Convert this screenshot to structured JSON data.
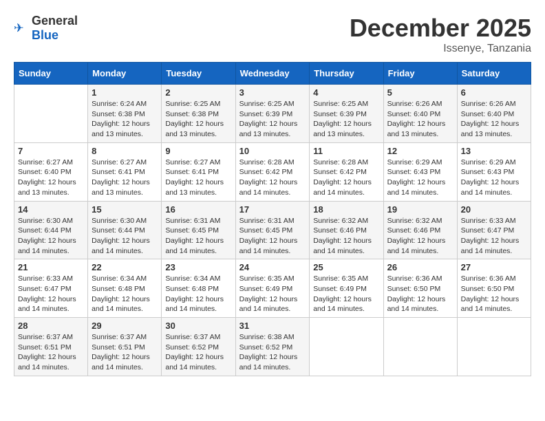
{
  "header": {
    "logo_general": "General",
    "logo_blue": "Blue",
    "month": "December 2025",
    "location": "Issenye, Tanzania"
  },
  "weekdays": [
    "Sunday",
    "Monday",
    "Tuesday",
    "Wednesday",
    "Thursday",
    "Friday",
    "Saturday"
  ],
  "weeks": [
    [
      {
        "day": "",
        "sunrise": "",
        "sunset": "",
        "daylight": ""
      },
      {
        "day": "1",
        "sunrise": "Sunrise: 6:24 AM",
        "sunset": "Sunset: 6:38 PM",
        "daylight": "Daylight: 12 hours and 13 minutes."
      },
      {
        "day": "2",
        "sunrise": "Sunrise: 6:25 AM",
        "sunset": "Sunset: 6:38 PM",
        "daylight": "Daylight: 12 hours and 13 minutes."
      },
      {
        "day": "3",
        "sunrise": "Sunrise: 6:25 AM",
        "sunset": "Sunset: 6:39 PM",
        "daylight": "Daylight: 12 hours and 13 minutes."
      },
      {
        "day": "4",
        "sunrise": "Sunrise: 6:25 AM",
        "sunset": "Sunset: 6:39 PM",
        "daylight": "Daylight: 12 hours and 13 minutes."
      },
      {
        "day": "5",
        "sunrise": "Sunrise: 6:26 AM",
        "sunset": "Sunset: 6:40 PM",
        "daylight": "Daylight: 12 hours and 13 minutes."
      },
      {
        "day": "6",
        "sunrise": "Sunrise: 6:26 AM",
        "sunset": "Sunset: 6:40 PM",
        "daylight": "Daylight: 12 hours and 13 minutes."
      }
    ],
    [
      {
        "day": "7",
        "sunrise": "Sunrise: 6:27 AM",
        "sunset": "Sunset: 6:40 PM",
        "daylight": "Daylight: 12 hours and 13 minutes."
      },
      {
        "day": "8",
        "sunrise": "Sunrise: 6:27 AM",
        "sunset": "Sunset: 6:41 PM",
        "daylight": "Daylight: 12 hours and 13 minutes."
      },
      {
        "day": "9",
        "sunrise": "Sunrise: 6:27 AM",
        "sunset": "Sunset: 6:41 PM",
        "daylight": "Daylight: 12 hours and 13 minutes."
      },
      {
        "day": "10",
        "sunrise": "Sunrise: 6:28 AM",
        "sunset": "Sunset: 6:42 PM",
        "daylight": "Daylight: 12 hours and 14 minutes."
      },
      {
        "day": "11",
        "sunrise": "Sunrise: 6:28 AM",
        "sunset": "Sunset: 6:42 PM",
        "daylight": "Daylight: 12 hours and 14 minutes."
      },
      {
        "day": "12",
        "sunrise": "Sunrise: 6:29 AM",
        "sunset": "Sunset: 6:43 PM",
        "daylight": "Daylight: 12 hours and 14 minutes."
      },
      {
        "day": "13",
        "sunrise": "Sunrise: 6:29 AM",
        "sunset": "Sunset: 6:43 PM",
        "daylight": "Daylight: 12 hours and 14 minutes."
      }
    ],
    [
      {
        "day": "14",
        "sunrise": "Sunrise: 6:30 AM",
        "sunset": "Sunset: 6:44 PM",
        "daylight": "Daylight: 12 hours and 14 minutes."
      },
      {
        "day": "15",
        "sunrise": "Sunrise: 6:30 AM",
        "sunset": "Sunset: 6:44 PM",
        "daylight": "Daylight: 12 hours and 14 minutes."
      },
      {
        "day": "16",
        "sunrise": "Sunrise: 6:31 AM",
        "sunset": "Sunset: 6:45 PM",
        "daylight": "Daylight: 12 hours and 14 minutes."
      },
      {
        "day": "17",
        "sunrise": "Sunrise: 6:31 AM",
        "sunset": "Sunset: 6:45 PM",
        "daylight": "Daylight: 12 hours and 14 minutes."
      },
      {
        "day": "18",
        "sunrise": "Sunrise: 6:32 AM",
        "sunset": "Sunset: 6:46 PM",
        "daylight": "Daylight: 12 hours and 14 minutes."
      },
      {
        "day": "19",
        "sunrise": "Sunrise: 6:32 AM",
        "sunset": "Sunset: 6:46 PM",
        "daylight": "Daylight: 12 hours and 14 minutes."
      },
      {
        "day": "20",
        "sunrise": "Sunrise: 6:33 AM",
        "sunset": "Sunset: 6:47 PM",
        "daylight": "Daylight: 12 hours and 14 minutes."
      }
    ],
    [
      {
        "day": "21",
        "sunrise": "Sunrise: 6:33 AM",
        "sunset": "Sunset: 6:47 PM",
        "daylight": "Daylight: 12 hours and 14 minutes."
      },
      {
        "day": "22",
        "sunrise": "Sunrise: 6:34 AM",
        "sunset": "Sunset: 6:48 PM",
        "daylight": "Daylight: 12 hours and 14 minutes."
      },
      {
        "day": "23",
        "sunrise": "Sunrise: 6:34 AM",
        "sunset": "Sunset: 6:48 PM",
        "daylight": "Daylight: 12 hours and 14 minutes."
      },
      {
        "day": "24",
        "sunrise": "Sunrise: 6:35 AM",
        "sunset": "Sunset: 6:49 PM",
        "daylight": "Daylight: 12 hours and 14 minutes."
      },
      {
        "day": "25",
        "sunrise": "Sunrise: 6:35 AM",
        "sunset": "Sunset: 6:49 PM",
        "daylight": "Daylight: 12 hours and 14 minutes."
      },
      {
        "day": "26",
        "sunrise": "Sunrise: 6:36 AM",
        "sunset": "Sunset: 6:50 PM",
        "daylight": "Daylight: 12 hours and 14 minutes."
      },
      {
        "day": "27",
        "sunrise": "Sunrise: 6:36 AM",
        "sunset": "Sunset: 6:50 PM",
        "daylight": "Daylight: 12 hours and 14 minutes."
      }
    ],
    [
      {
        "day": "28",
        "sunrise": "Sunrise: 6:37 AM",
        "sunset": "Sunset: 6:51 PM",
        "daylight": "Daylight: 12 hours and 14 minutes."
      },
      {
        "day": "29",
        "sunrise": "Sunrise: 6:37 AM",
        "sunset": "Sunset: 6:51 PM",
        "daylight": "Daylight: 12 hours and 14 minutes."
      },
      {
        "day": "30",
        "sunrise": "Sunrise: 6:37 AM",
        "sunset": "Sunset: 6:52 PM",
        "daylight": "Daylight: 12 hours and 14 minutes."
      },
      {
        "day": "31",
        "sunrise": "Sunrise: 6:38 AM",
        "sunset": "Sunset: 6:52 PM",
        "daylight": "Daylight: 12 hours and 14 minutes."
      },
      {
        "day": "",
        "sunrise": "",
        "sunset": "",
        "daylight": ""
      },
      {
        "day": "",
        "sunrise": "",
        "sunset": "",
        "daylight": ""
      },
      {
        "day": "",
        "sunrise": "",
        "sunset": "",
        "daylight": ""
      }
    ]
  ]
}
